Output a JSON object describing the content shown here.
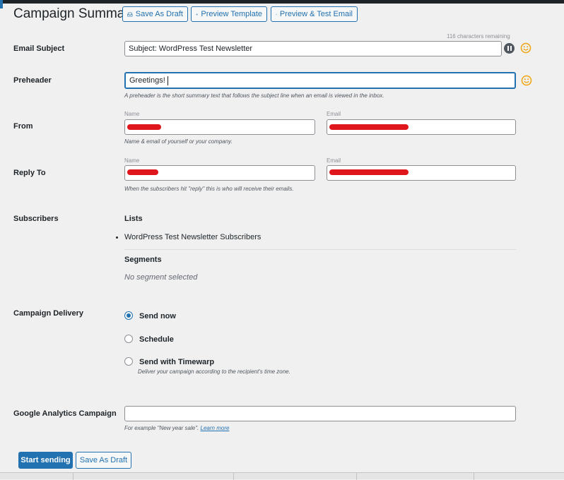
{
  "header": {
    "title": "Campaign Summary",
    "buttons": {
      "save_draft": "Save As Draft",
      "preview_template": "Preview Template",
      "preview_test_email": "Preview & Test Email"
    }
  },
  "email_subject": {
    "label": "Email Subject",
    "counter": "116 characters remaining",
    "value": "Subject: WordPress Test Newsletter"
  },
  "preheader": {
    "label": "Preheader",
    "value": "Greetings!",
    "help": "A preheader is the short summary text that follows the subject line when an email is viewed in the inbox."
  },
  "from": {
    "label": "From",
    "name_caption": "Name",
    "email_caption": "Email",
    "help": "Name & email of yourself or your company."
  },
  "reply_to": {
    "label": "Reply To",
    "name_caption": "Name",
    "email_caption": "Email",
    "help": "When the subscribers hit \"reply\" this is who will receive their emails."
  },
  "subscribers": {
    "label": "Subscribers",
    "lists_heading": "Lists",
    "lists": [
      "WordPress Test Newsletter Subscribers"
    ],
    "segments_heading": "Segments",
    "segments_empty": "No segment selected"
  },
  "delivery": {
    "label": "Campaign Delivery",
    "options": [
      {
        "label": "Send now",
        "checked": true
      },
      {
        "label": "Schedule",
        "checked": false
      },
      {
        "label": "Send with Timewarp",
        "checked": false,
        "help": "Deliver your campaign according to the recipient's time zone."
      }
    ]
  },
  "analytics": {
    "label": "Google Analytics Campaign",
    "value": "",
    "help_prefix": "For example \"New year sale\".",
    "help_link": "Learn more"
  },
  "footer": {
    "start_sending": "Start sending",
    "save_draft": "Save As Draft"
  },
  "colors": {
    "accent": "#2271b1",
    "emoji": "#f0a30a",
    "redaction": "#e0161d"
  }
}
